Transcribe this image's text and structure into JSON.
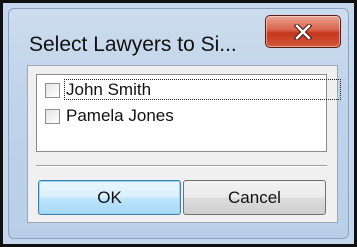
{
  "window": {
    "title": "Select Lawyers to Si..."
  },
  "close_button": {
    "icon": "close-icon"
  },
  "lawyers": [
    {
      "name": "John Smith",
      "checked": false,
      "focused": true
    },
    {
      "name": "Pamela Jones",
      "checked": false,
      "focused": false
    }
  ],
  "buttons": {
    "ok": "OK",
    "cancel": "Cancel"
  }
}
